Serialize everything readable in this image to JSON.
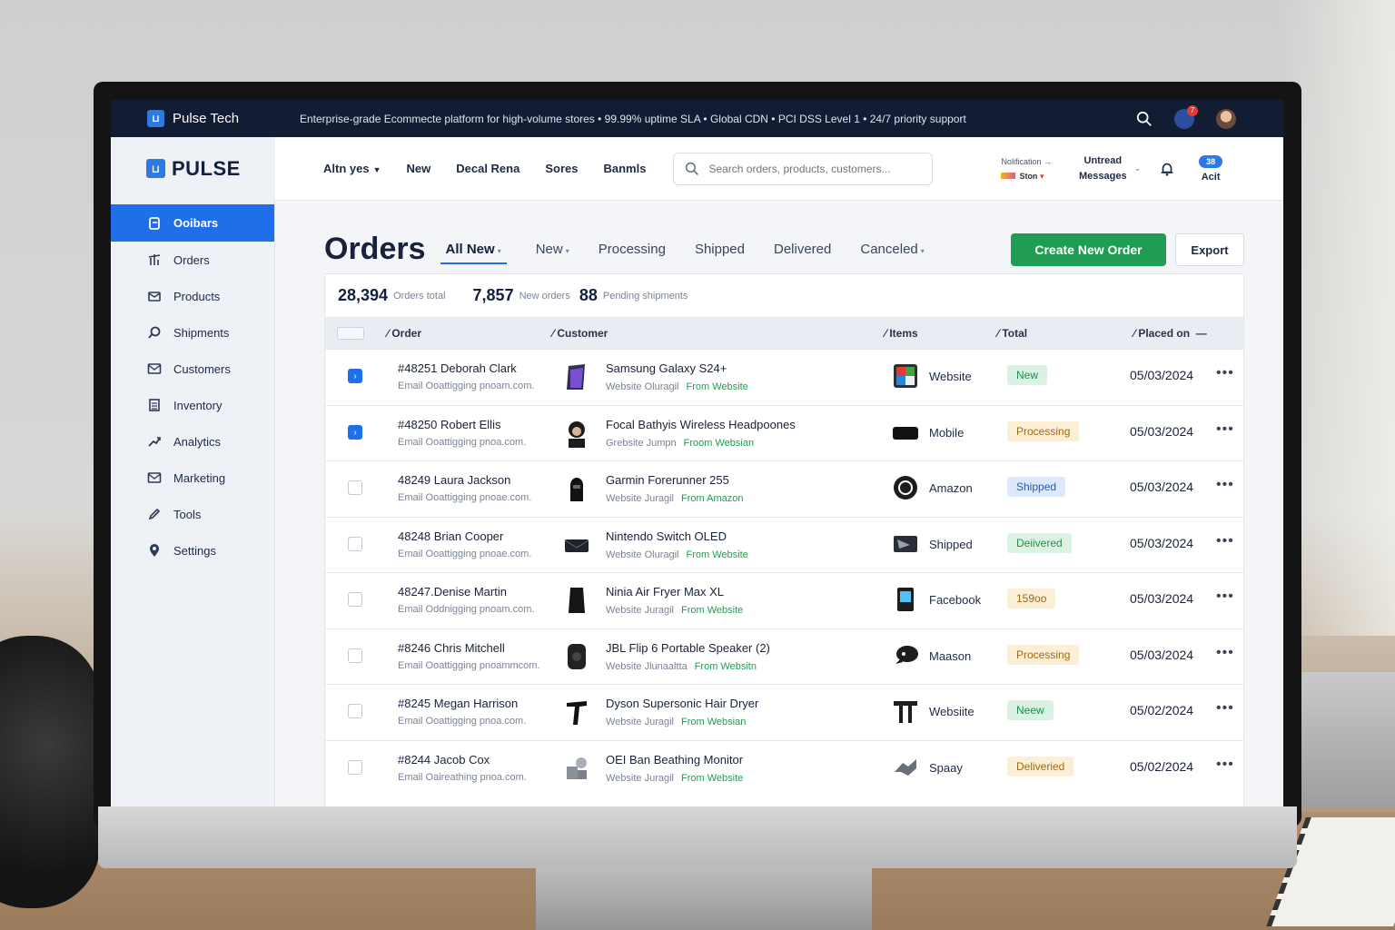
{
  "topbar": {
    "brand": "Pulse Tech",
    "tagline": "Enterprise-grade Ecommecte platform for high-volume stores  •  99.99% uptime SLA  •  Global CDN  •  PCI DSS Level 1  •  24/7 priority support",
    "notification_count": "7"
  },
  "header": {
    "brand": "PULSE",
    "nav": [
      {
        "label": "Altn yes",
        "has_caret": true
      },
      {
        "label": "New"
      },
      {
        "label": "Decal Rena"
      },
      {
        "label": "Sores"
      },
      {
        "label": "Banmls"
      }
    ],
    "search_placeholder": "Search orders, products, customers...",
    "notification_label": "Nolification",
    "notification_sub": "Ston",
    "messages_line1": "Untread",
    "messages_line2": "Messages",
    "account_pill": "38",
    "account_label": "Acit"
  },
  "sidebar": {
    "items": [
      {
        "label": "Ooibars",
        "icon": "orders-icon",
        "active": true
      },
      {
        "label": "Orders",
        "icon": "chart-icon"
      },
      {
        "label": "Products",
        "icon": "box-icon"
      },
      {
        "label": "Shipments",
        "icon": "truck-icon"
      },
      {
        "label": "Customers",
        "icon": "mail-icon"
      },
      {
        "label": "Inventory",
        "icon": "list-icon"
      },
      {
        "label": "Analytics",
        "icon": "analytics-icon"
      },
      {
        "label": "Marketing",
        "icon": "megaphone-icon"
      },
      {
        "label": "Tools",
        "icon": "pen-icon"
      },
      {
        "label": "Settings",
        "icon": "pin-icon"
      }
    ]
  },
  "main": {
    "title": "Orders",
    "tabs": [
      {
        "label": "All New",
        "active": true,
        "has_caret": true
      },
      {
        "label": "New",
        "has_caret": true
      },
      {
        "label": "Processing"
      },
      {
        "label": "Shipped"
      },
      {
        "label": "Delivered"
      },
      {
        "label": "Canceled",
        "has_caret": true
      }
    ],
    "create_button": "Create New Order",
    "export_button": "Export",
    "stats": [
      {
        "value": "28,394",
        "label": "Orders total"
      },
      {
        "value": "7,857",
        "label": "New orders"
      },
      {
        "value": "88",
        "label": "Pending shipments"
      }
    ],
    "columns": [
      "Order",
      "Customer",
      "Items",
      "Total",
      "Placed on"
    ],
    "rows": [
      {
        "checked": true,
        "order": "#48251 Deborah Clark",
        "email": "Email Ooattigging pnoam.com.",
        "product": "Samsung Galaxy S24+",
        "prod_sub": "Website Oluragil",
        "source": "From Website",
        "channel": "Website",
        "status": "New",
        "status_class": "b-new",
        "date": "05/03/2024"
      },
      {
        "checked": true,
        "order": "#48250 Robert Ellis",
        "email": "Email Ooattigging pnoa.com.",
        "product": "Focal Bathyis Wireless Headpoones",
        "prod_sub": "Grebsite Jumpn",
        "source": "Froom Websian",
        "channel": "Mobile",
        "status": "Processing",
        "status_class": "b-proc",
        "date": "05/03/2024"
      },
      {
        "checked": false,
        "order": "48249 Laura Jackson",
        "email": "Email Ooattigging pnoae.com.",
        "product": "Garmin Forerunner 255",
        "prod_sub": "Website Juragil",
        "source": "From Amazon",
        "channel": "Amazon",
        "status": "Shipped",
        "status_class": "b-ship",
        "date": "05/03/2024"
      },
      {
        "checked": false,
        "order": "48248 Brian Cooper",
        "email": "Email Ooattigging pnoae.com.",
        "product": "Nintendo Switch OLED",
        "prod_sub": "Website Oluragil",
        "source": "From Website",
        "channel": "Shipped",
        "status": "Deiivered",
        "status_class": "b-deliv",
        "date": "05/03/2024"
      },
      {
        "checked": false,
        "order": "48247.Denise Martin",
        "email": "Email Oddnigging pnoam.com.",
        "product": "Ninia Air Fryer Max XL",
        "prod_sub": "Website Juragil",
        "source": "From Website",
        "channel": "Facebook",
        "status": "159oo",
        "status_class": "b-oth",
        "date": "05/03/2024"
      },
      {
        "checked": false,
        "order": "#8246 Chris Mitchell",
        "email": "Email Ooattigging pnoammcom.",
        "product": "JBL Flip 6 Portable Speaker (2)",
        "prod_sub": "Website Jlunaaltta",
        "source": "From Websitn",
        "channel": "Maason",
        "status": "Processing",
        "status_class": "b-proc",
        "date": "05/03/2024"
      },
      {
        "checked": false,
        "order": "#8245 Megan Harrison",
        "email": "Email Ooattigging pnoa.com.",
        "product": "Dyson Supersonic Hair Dryer",
        "prod_sub": "Website Juragil",
        "source": "From Websian",
        "channel": "Websiite",
        "status": "Neew",
        "status_class": "b-new",
        "date": "05/02/2024"
      },
      {
        "checked": false,
        "order": "#8244 Jacob Cox",
        "email": "Email Oaireathing pnoa.com.",
        "product": "OEI Ban Beathing Monitor",
        "prod_sub": "Website Juragil",
        "source": "From Website",
        "channel": "Spaay",
        "status": "Deliveried",
        "status_class": "b-proc",
        "date": "05/02/2024"
      }
    ]
  }
}
